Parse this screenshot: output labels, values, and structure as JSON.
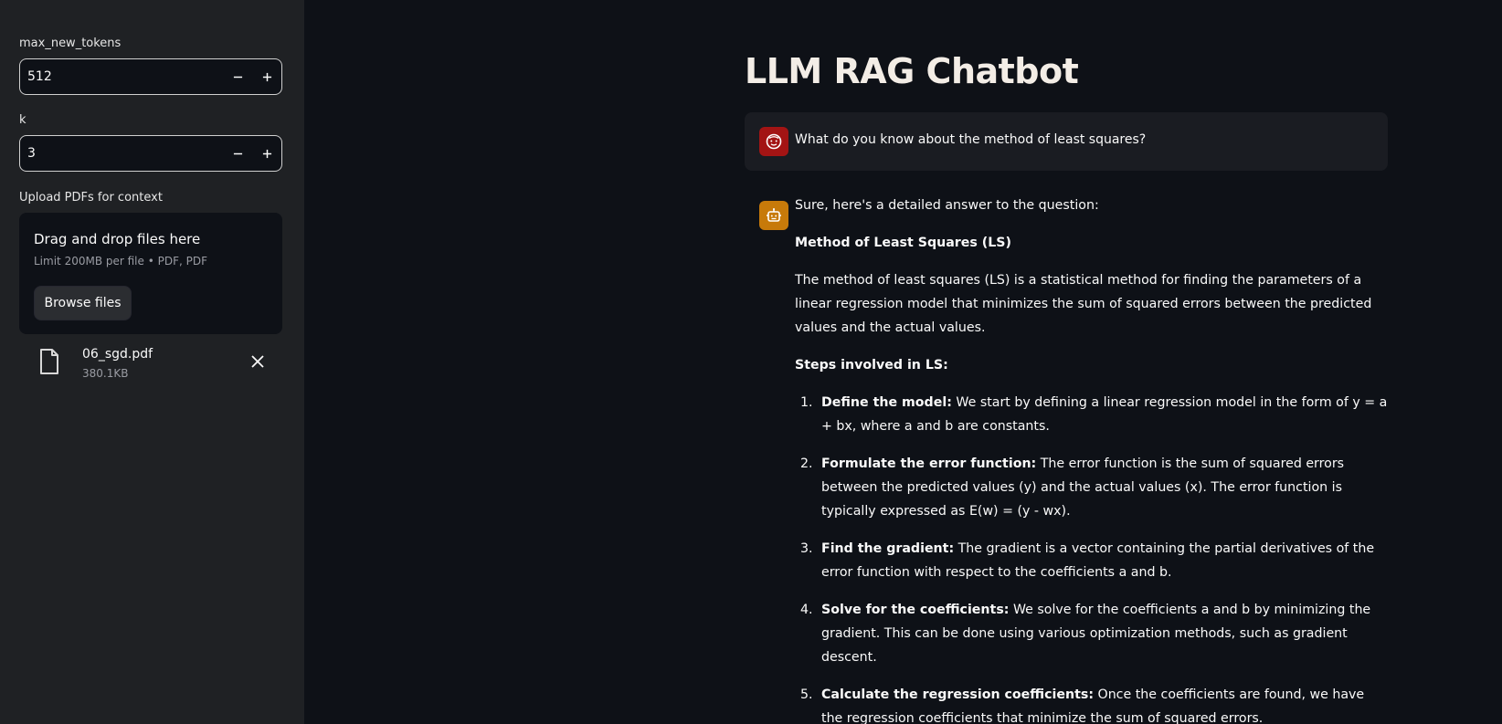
{
  "sidebar": {
    "max_tokens_label": "max_new_tokens",
    "max_tokens_value": "512",
    "k_label": "k",
    "k_value": "3",
    "upload_label": "Upload PDFs for context",
    "dropzone_title": "Drag and drop files here",
    "dropzone_sub": "Limit 200MB per file • PDF, PDF",
    "browse_label": "Browse files",
    "file_name": "06_sgd.pdf",
    "file_size": "380.1KB"
  },
  "main": {
    "title": "LLM RAG Chatbot",
    "user_message": "What do you know about the method of least squares?",
    "bot": {
      "intro": "Sure, here's a detailed answer to the question:",
      "heading": "Method of Least Squares (LS)",
      "paragraph": "The method of least squares (LS) is a statistical method for finding the parameters of a linear regression model that minimizes the sum of squared errors between the predicted values and the actual values.",
      "steps_heading": "Steps involved in LS:",
      "steps": [
        {
          "num": "1.",
          "bold": "Define the model:",
          "text": " We start by defining a linear regression model in the form of y = a + bx, where a and b are constants."
        },
        {
          "num": "2.",
          "bold": "Formulate the error function:",
          "text": " The error function is the sum of squared errors between the predicted values (y) and the actual values (x). The error function is typically expressed as E(w) = (y - wx)."
        },
        {
          "num": "3.",
          "bold": "Find the gradient:",
          "text": " The gradient is a vector containing the partial derivatives of the error function with respect to the coefficients a and b."
        },
        {
          "num": "4.",
          "bold": "Solve for the coefficients:",
          "text": " We solve for the coefficients a and b by minimizing the gradient. This can be done using various optimization methods, such as gradient descent."
        },
        {
          "num": "5.",
          "bold": "Calculate the regression coefficients:",
          "text": " Once the coefficients are found, we have the regression coefficients that minimize the sum of squared errors."
        }
      ]
    }
  },
  "colors": {
    "user_avatar": "#a31414",
    "bot_avatar": "#c77a0a",
    "sidebar_bg": "#1f2124",
    "main_bg": "#0e1117"
  }
}
